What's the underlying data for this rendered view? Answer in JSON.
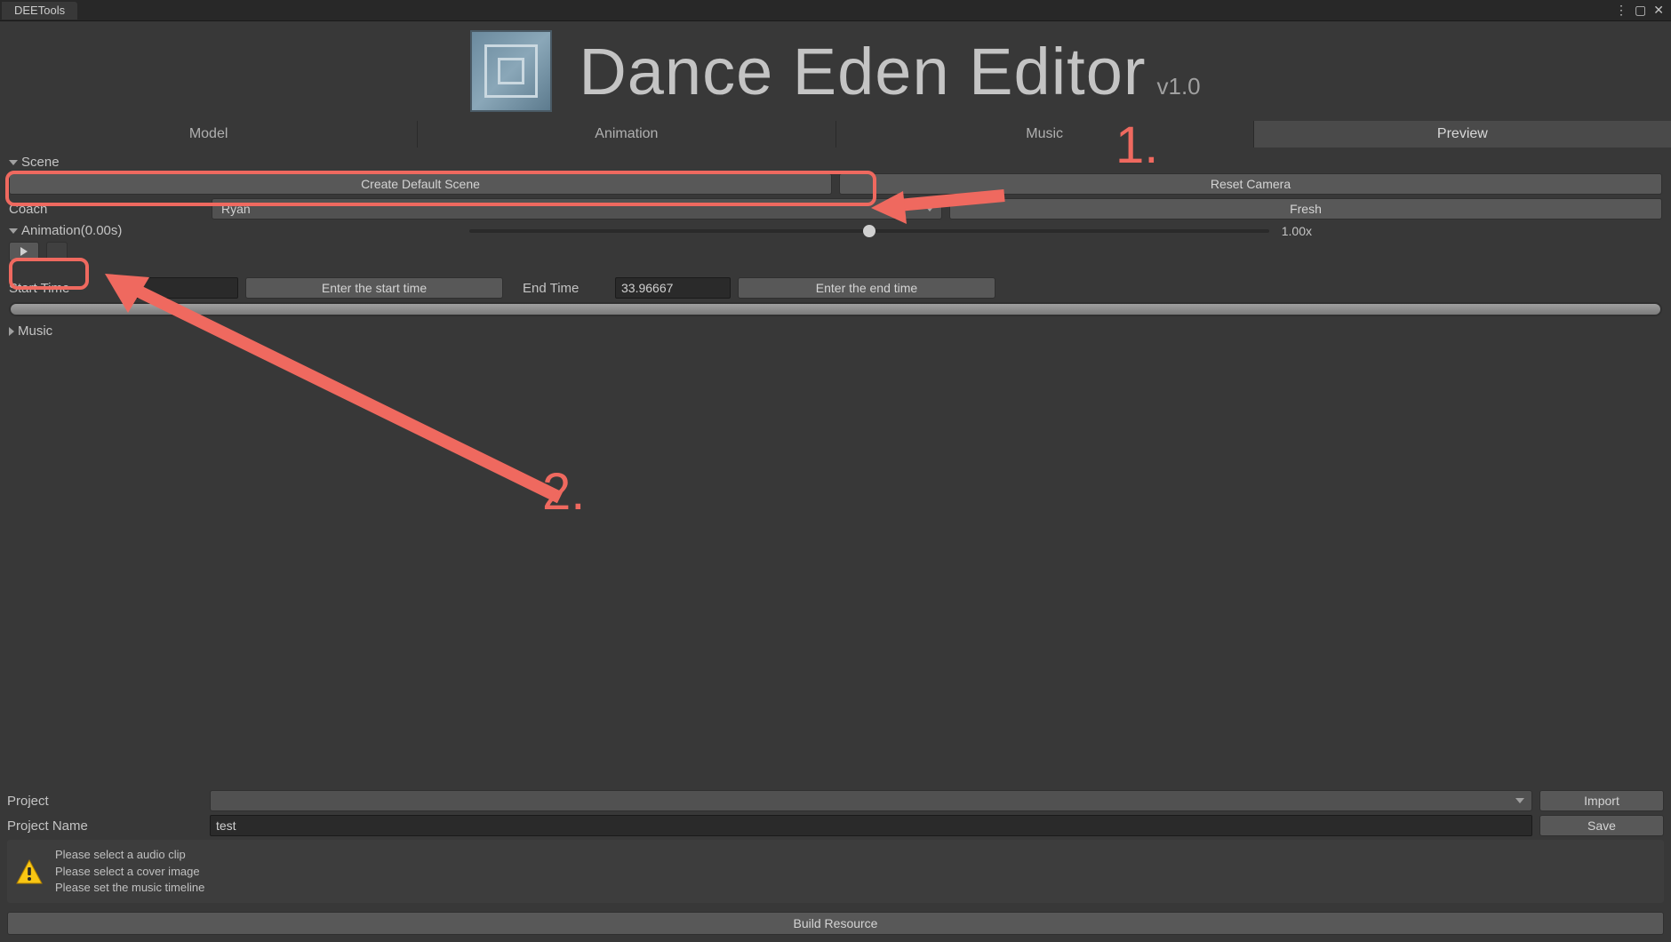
{
  "window": {
    "tab_title": "DEETools"
  },
  "header": {
    "title": "Dance Eden Editor",
    "version": "v1.0"
  },
  "tabs": [
    "Model",
    "Animation",
    "Music",
    "Preview"
  ],
  "active_tab_index": 3,
  "scene": {
    "label": "Scene",
    "create_btn": "Create Default Scene",
    "reset_btn": "Reset Camera"
  },
  "coach": {
    "label": "Coach",
    "value": "Ryan",
    "fresh_btn": "Fresh"
  },
  "animation": {
    "label": "Animation(0.00s)",
    "speed": "1.00x",
    "start_label": "Start Time",
    "start_btn": "Enter the start time",
    "end_label": "End Time",
    "end_value": "33.96667",
    "end_btn": "Enter the end time"
  },
  "music": {
    "label": "Music"
  },
  "project": {
    "label": "Project",
    "import_btn": "Import",
    "name_label": "Project Name",
    "name_value": "test",
    "save_btn": "Save"
  },
  "warnings": [
    "Please select a audio clip",
    "Please select a cover image",
    "Please set the music timeline"
  ],
  "build_btn": "Build Resource",
  "annotations": {
    "one": "1.",
    "two": "2."
  }
}
